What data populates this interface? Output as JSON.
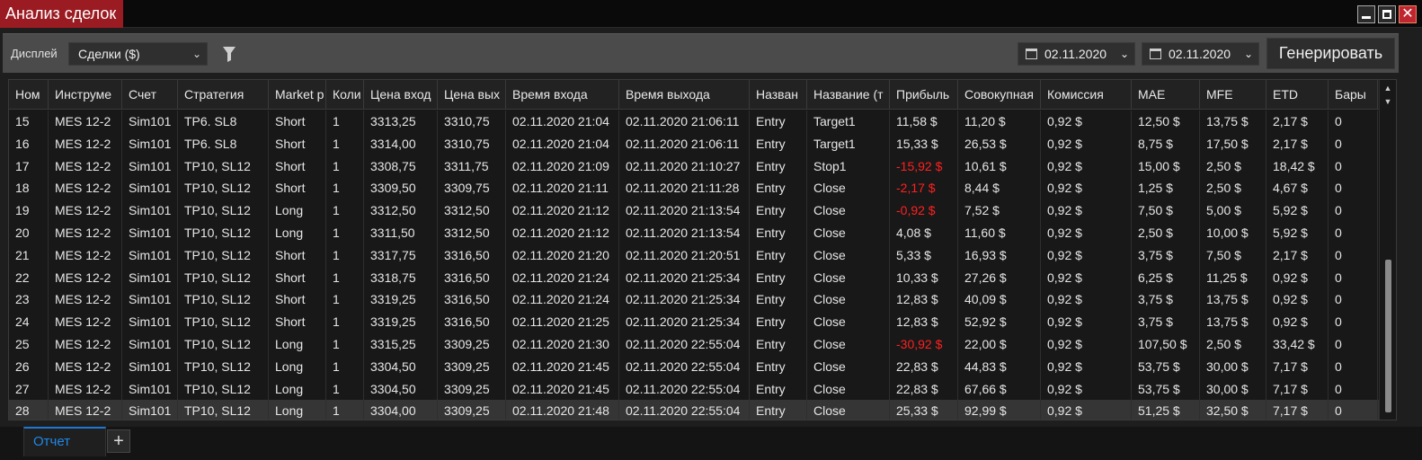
{
  "window": {
    "title": "Анализ сделок",
    "buttons": {
      "minimize": "minimize",
      "maximize": "maximize",
      "close": "✕"
    }
  },
  "toolbar": {
    "display_label": "Дисплей",
    "display_value": "Сделки ($)",
    "date_from": "02.11.2020",
    "date_to": "02.11.2020",
    "generate_label": "Генерировать"
  },
  "table": {
    "columns": [
      "Ном",
      "Инструме",
      "Счет",
      "Стратегия",
      "Market p",
      "Коли",
      "Цена вход",
      "Цена вых",
      "Время входа",
      "Время выхода",
      "Назван",
      "Название (т",
      "Прибыль",
      "Совокупная",
      "Комиссия",
      "MAE",
      "MFE",
      "ETD",
      "Бары"
    ],
    "rows": [
      [
        "15",
        "MES 12-2",
        "Sim101",
        "TP6. SL8",
        "Short",
        "1",
        "3313,25",
        "3310,75",
        "02.11.2020 21:04",
        "02.11.2020 21:06:11",
        "Entry",
        "Target1",
        "11,58 $",
        "11,20 $",
        "0,92 $",
        "12,50 $",
        "13,75 $",
        "2,17 $",
        "0"
      ],
      [
        "16",
        "MES 12-2",
        "Sim101",
        "TP6. SL8",
        "Short",
        "1",
        "3314,00",
        "3310,75",
        "02.11.2020 21:04",
        "02.11.2020 21:06:11",
        "Entry",
        "Target1",
        "15,33 $",
        "26,53 $",
        "0,92 $",
        "8,75 $",
        "17,50 $",
        "2,17 $",
        "0"
      ],
      [
        "17",
        "MES 12-2",
        "Sim101",
        "TP10, SL12",
        "Short",
        "1",
        "3308,75",
        "3311,75",
        "02.11.2020 21:09",
        "02.11.2020 21:10:27",
        "Entry",
        "Stop1",
        "-15,92 $",
        "10,61 $",
        "0,92 $",
        "15,00 $",
        "2,50 $",
        "18,42 $",
        "0"
      ],
      [
        "18",
        "MES 12-2",
        "Sim101",
        "TP10, SL12",
        "Short",
        "1",
        "3309,50",
        "3309,75",
        "02.11.2020 21:11",
        "02.11.2020 21:11:28",
        "Entry",
        "Close",
        "-2,17 $",
        "8,44 $",
        "0,92 $",
        "1,25 $",
        "2,50 $",
        "4,67 $",
        "0"
      ],
      [
        "19",
        "MES 12-2",
        "Sim101",
        "TP10, SL12",
        "Long",
        "1",
        "3312,50",
        "3312,50",
        "02.11.2020 21:12",
        "02.11.2020 21:13:54",
        "Entry",
        "Close",
        "-0,92 $",
        "7,52 $",
        "0,92 $",
        "7,50 $",
        "5,00 $",
        "5,92 $",
        "0"
      ],
      [
        "20",
        "MES 12-2",
        "Sim101",
        "TP10, SL12",
        "Long",
        "1",
        "3311,50",
        "3312,50",
        "02.11.2020 21:12",
        "02.11.2020 21:13:54",
        "Entry",
        "Close",
        "4,08 $",
        "11,60 $",
        "0,92 $",
        "2,50 $",
        "10,00 $",
        "5,92 $",
        "0"
      ],
      [
        "21",
        "MES 12-2",
        "Sim101",
        "TP10, SL12",
        "Short",
        "1",
        "3317,75",
        "3316,50",
        "02.11.2020 21:20",
        "02.11.2020 21:20:51",
        "Entry",
        "Close",
        "5,33 $",
        "16,93 $",
        "0,92 $",
        "3,75 $",
        "7,50 $",
        "2,17 $",
        "0"
      ],
      [
        "22",
        "MES 12-2",
        "Sim101",
        "TP10, SL12",
        "Short",
        "1",
        "3318,75",
        "3316,50",
        "02.11.2020 21:24",
        "02.11.2020 21:25:34",
        "Entry",
        "Close",
        "10,33 $",
        "27,26 $",
        "0,92 $",
        "6,25 $",
        "11,25 $",
        "0,92 $",
        "0"
      ],
      [
        "23",
        "MES 12-2",
        "Sim101",
        "TP10, SL12",
        "Short",
        "1",
        "3319,25",
        "3316,50",
        "02.11.2020 21:24",
        "02.11.2020 21:25:34",
        "Entry",
        "Close",
        "12,83 $",
        "40,09 $",
        "0,92 $",
        "3,75 $",
        "13,75 $",
        "0,92 $",
        "0"
      ],
      [
        "24",
        "MES 12-2",
        "Sim101",
        "TP10, SL12",
        "Short",
        "1",
        "3319,25",
        "3316,50",
        "02.11.2020 21:25",
        "02.11.2020 21:25:34",
        "Entry",
        "Close",
        "12,83 $",
        "52,92 $",
        "0,92 $",
        "3,75 $",
        "13,75 $",
        "0,92 $",
        "0"
      ],
      [
        "25",
        "MES 12-2",
        "Sim101",
        "TP10, SL12",
        "Long",
        "1",
        "3315,25",
        "3309,25",
        "02.11.2020 21:30",
        "02.11.2020 22:55:04",
        "Entry",
        "Close",
        "-30,92 $",
        "22,00 $",
        "0,92 $",
        "107,50 $",
        "2,50 $",
        "33,42 $",
        "0"
      ],
      [
        "26",
        "MES 12-2",
        "Sim101",
        "TP10, SL12",
        "Long",
        "1",
        "3304,50",
        "3309,25",
        "02.11.2020 21:45",
        "02.11.2020 22:55:04",
        "Entry",
        "Close",
        "22,83 $",
        "44,83 $",
        "0,92 $",
        "53,75 $",
        "30,00 $",
        "7,17 $",
        "0"
      ],
      [
        "27",
        "MES 12-2",
        "Sim101",
        "TP10, SL12",
        "Long",
        "1",
        "3304,50",
        "3309,25",
        "02.11.2020 21:45",
        "02.11.2020 22:55:04",
        "Entry",
        "Close",
        "22,83 $",
        "67,66 $",
        "0,92 $",
        "53,75 $",
        "30,00 $",
        "7,17 $",
        "0"
      ],
      [
        "28",
        "MES 12-2",
        "Sim101",
        "TP10, SL12",
        "Long",
        "1",
        "3304,00",
        "3309,25",
        "02.11.2020 21:48",
        "02.11.2020 22:55:04",
        "Entry",
        "Close",
        "25,33 $",
        "92,99 $",
        "0,92 $",
        "51,25 $",
        "32,50 $",
        "7,17 $",
        "0"
      ]
    ],
    "selected_row": 13,
    "negative_color": "#ff2020"
  },
  "tabs": {
    "items": [
      {
        "label": "Отчет"
      }
    ],
    "add_label": "+"
  },
  "colors": {
    "title_bg": "#9b1b22",
    "accent": "#1e88e5",
    "close_btn": "#c0262f"
  }
}
